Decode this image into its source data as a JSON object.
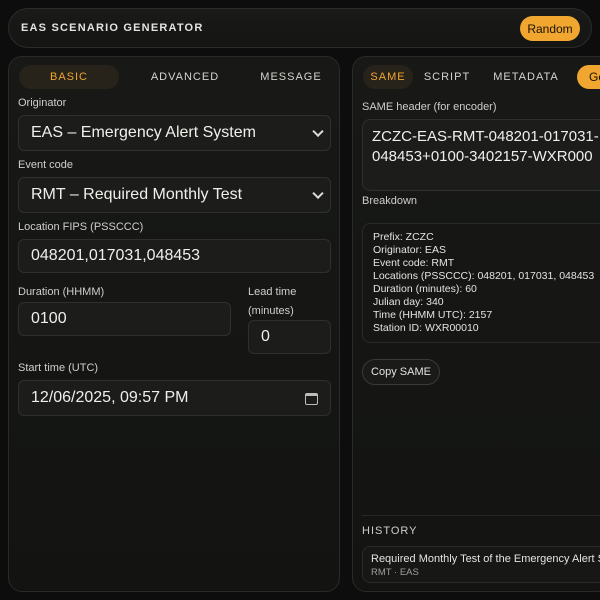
{
  "header": {
    "title": "EAS SCENARIO GENERATOR",
    "random_label": "Random"
  },
  "left": {
    "tabs": [
      {
        "label": "BASIC",
        "active": true
      },
      {
        "label": "ADVANCED",
        "active": false
      },
      {
        "label": "MESSAGE",
        "active": false
      }
    ],
    "originator": {
      "label": "Originator",
      "value": "EAS – Emergency Alert System"
    },
    "event_code": {
      "label": "Event code",
      "value": "RMT – Required Monthly Test"
    },
    "location": {
      "label": "Location FIPS (PSSCCC)",
      "value": "048201,017031,048453"
    },
    "duration": {
      "label": "Duration (HHMM)",
      "value": "0100"
    },
    "lead_time": {
      "label_line1": "Lead time",
      "label_line2": "(minutes)",
      "value": "0"
    },
    "start_time": {
      "label": "Start time (UTC)",
      "value": "12/06/2025, 09:57 PM"
    }
  },
  "right": {
    "tabs": [
      {
        "label": "SAME",
        "active": true
      },
      {
        "label": "SCRIPT",
        "active": false
      },
      {
        "label": "METADATA",
        "active": false
      }
    ],
    "generate_label": "Ge",
    "same_header": {
      "label": "SAME header (for encoder)",
      "line1": "ZCZC-EAS-RMT-048201-017031-",
      "line2": "048453+0100-3402157-WXR000"
    },
    "breakdown": {
      "label": "Breakdown",
      "lines": [
        "Prefix: ZCZC",
        "Originator: EAS",
        "Event code: RMT",
        "Locations (PSSCCC): 048201, 017031, 048453",
        "Duration (minutes): 60",
        "Julian day: 340",
        "Time (HHMM UTC): 2157",
        "Station ID: WXR00010"
      ]
    },
    "copy_label": "Copy SAME",
    "history": {
      "label": "HISTORY",
      "items": [
        {
          "title": "Required Monthly Test of the Emergency Alert S",
          "meta": "RMT · EAS"
        }
      ]
    }
  },
  "colors": {
    "accent": "#f0a62f",
    "background": "#0c0d0c",
    "panel": "#181917",
    "field": "#1c1d1b"
  },
  "icons": {
    "select_arrow": "chevron-down-icon",
    "date_picker": "calendar-icon"
  }
}
